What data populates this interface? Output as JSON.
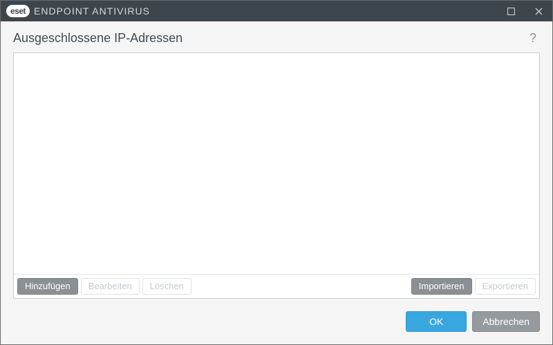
{
  "brand": {
    "badge": "eset",
    "product": "ENDPOINT ANTIVIRUS"
  },
  "page": {
    "title": "Ausgeschlossene IP-Adressen"
  },
  "toolbar": {
    "add": "Hinzufügen",
    "edit": "Bearbeiten",
    "delete": "Löschen",
    "import": "Importieren",
    "export": "Exportieren"
  },
  "footer": {
    "ok": "OK",
    "cancel": "Abbrechen"
  },
  "list": {
    "items": []
  }
}
